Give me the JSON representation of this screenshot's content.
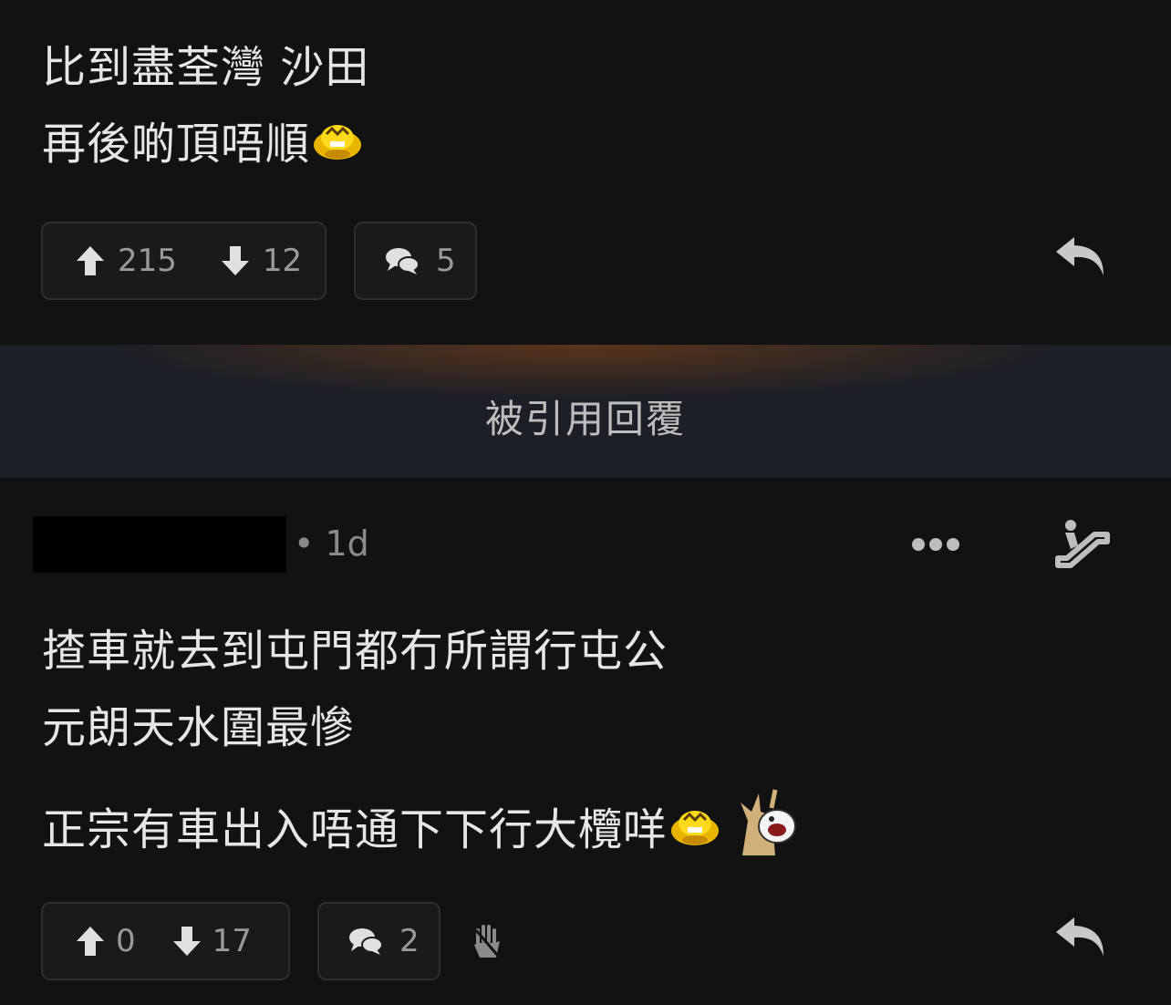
{
  "post1": {
    "lines": [
      "比到盡荃灣 沙田",
      "再後啲頂唔順"
    ],
    "upvotes": "215",
    "downvotes": "12",
    "comments": "5"
  },
  "divider": {
    "label": "被引用回覆"
  },
  "post2": {
    "meta": "• 1d",
    "lines": [
      "揸車就去到屯門都冇所謂行屯公",
      "元朗天水圍最慘",
      "正宗有車出入唔通下下行大欖咩"
    ],
    "upvotes": "0",
    "downvotes": "17",
    "comments": "2"
  },
  "icons": {
    "upvote": "arrow-up-icon",
    "downvote": "arrow-down-icon",
    "comments": "speech-bubbles-icon",
    "reply": "reply-arrow-icon",
    "more": "more-dots-icon",
    "escalator": "escalator-icon",
    "hand": "raised-hand-icon"
  }
}
